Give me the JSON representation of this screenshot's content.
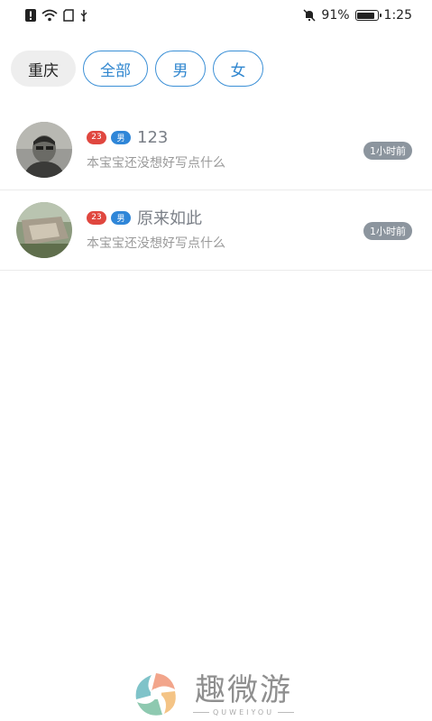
{
  "status_bar": {
    "battery": "91%",
    "battery_level": 0.91,
    "time": "1:25",
    "left_icons": [
      "alert-icon",
      "wifi-icon",
      "sim-icon",
      "usb-icon"
    ],
    "right_icons": [
      "mute-icon",
      "battery-icon"
    ]
  },
  "filters": {
    "city": "重庆",
    "options": [
      "全部",
      "男",
      "女"
    ],
    "accent_color": "#3a8fd6"
  },
  "users": [
    {
      "age": "23",
      "gender": "男",
      "name": "123",
      "signature": "本宝宝还没想好写点什么",
      "time": "1小时前"
    },
    {
      "age": "23",
      "gender": "男",
      "name": "原来如此",
      "signature": "本宝宝还没想好写点什么",
      "time": "1小时前"
    }
  ],
  "colors": {
    "age_badge": "#e0473f",
    "gender_badge": "#2f86d8",
    "time_badge": "#8c959e"
  },
  "brand": {
    "name": "趣微游",
    "sub": "QUWEIYOU"
  }
}
